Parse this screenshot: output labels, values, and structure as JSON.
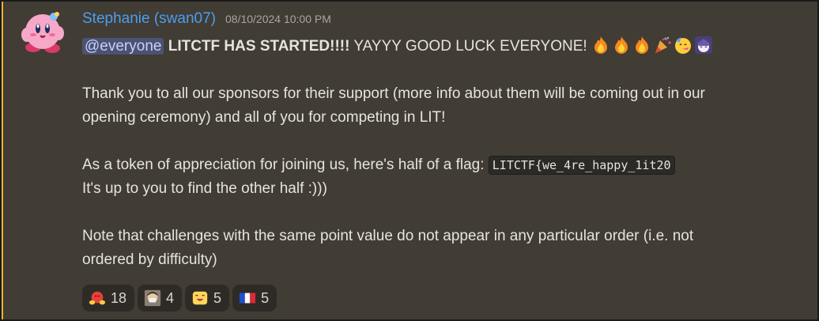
{
  "message": {
    "author": "Stephanie (swan07)",
    "timestamp": "08/10/2024 10:00 PM",
    "author_color": "#4b9ef0",
    "mention": "@everyone",
    "headline_bold": "LITCTF HAS STARTED!!!!",
    "headline_rest": " YAYYY GOOD LUCK EVERYONE!",
    "headline_emojis": [
      "fire-emoji",
      "fire-emoji",
      "fire-emoji",
      "tada-emoji",
      "partying-face-emoji",
      "anime-girl-emoji"
    ],
    "para2_line1": "Thank you to all our sponsors for their support (more info about them will be coming out in our",
    "para2_line2": "opening ceremony) and all of you for competing in LIT!",
    "para3_line1": "As a token of appreciation for joining us, here's half of a flag:",
    "flag": "LITCTF{we_4re_happy_1it20",
    "para3_line2": "It's up to you to find the other half :)))",
    "para4_line1": "Note that challenges with the same point value do not appear in any particular order (i.e. not",
    "para4_line2": "ordered by difficulty)"
  },
  "reactions": [
    {
      "icon": "hugging-face-emoji",
      "count": "18"
    },
    {
      "icon": "masked-person-emoji",
      "count": "4"
    },
    {
      "icon": "grinning-face-emoji",
      "count": "5"
    },
    {
      "icon": "france-flag-emoji",
      "count": "5"
    }
  ],
  "colors": {
    "background": "#413c34",
    "mention_bg": "#4c5273",
    "reaction_bg": "#2e2b26"
  }
}
